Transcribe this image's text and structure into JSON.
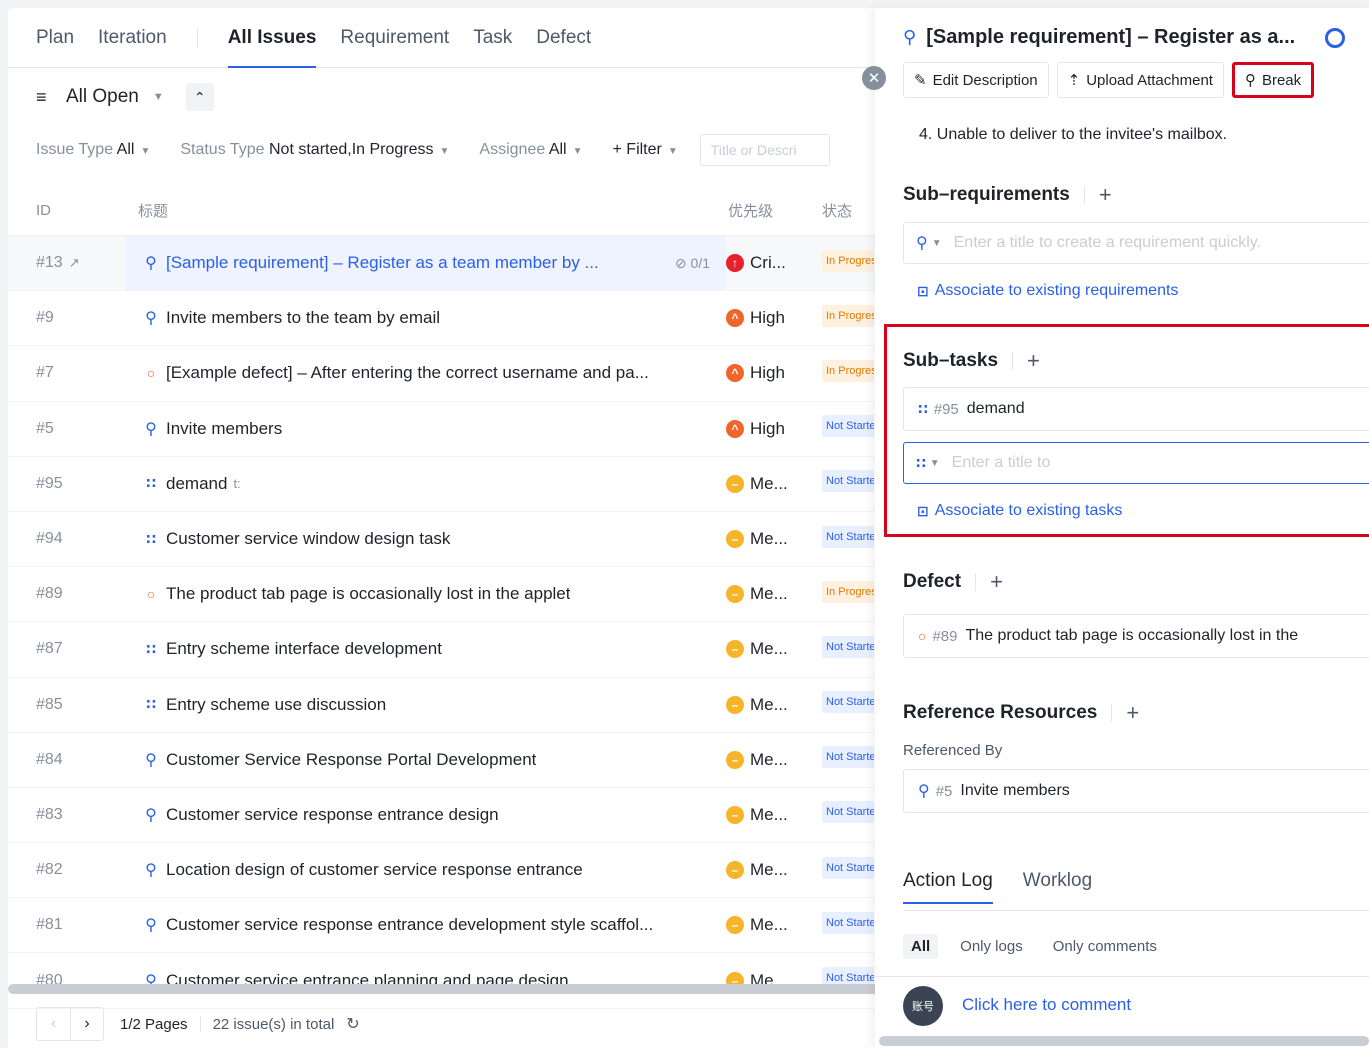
{
  "topnav": {
    "plan": "Plan",
    "iteration": "Iteration",
    "tabs": [
      "All Issues",
      "Requirement",
      "Task",
      "Defect"
    ]
  },
  "view": {
    "label": "All Open"
  },
  "filters": {
    "issue_type_label": "Issue Type",
    "issue_type_value": "All",
    "status_label": "Status Type",
    "status_value": "Not started,In Progress",
    "assignee_label": "Assignee",
    "assignee_value": "All",
    "add_filter": "+ Filter",
    "search_placeholder": "Title or Descri"
  },
  "table": {
    "headers": [
      "ID",
      "标题",
      "优先级",
      "状态"
    ],
    "rows": [
      {
        "id": "#13",
        "type": "requirement",
        "title": "[Sample requirement] – Register as a team member by ...",
        "sub": "0/1",
        "priority": "Cri...",
        "plevel": "critical",
        "status": "In Progress",
        "selected": true
      },
      {
        "id": "#9",
        "type": "requirement",
        "title": "Invite members to the team by email",
        "priority": "High",
        "plevel": "high",
        "status": "In Progress"
      },
      {
        "id": "#7",
        "type": "defect",
        "title": "[Example defect] – After entering the correct username and pa...",
        "priority": "High",
        "plevel": "high",
        "status": "In Progress"
      },
      {
        "id": "#5",
        "type": "requirement",
        "title": "Invite members",
        "priority": "High",
        "plevel": "high",
        "status": "Not Started"
      },
      {
        "id": "#95",
        "type": "task",
        "title": "demand",
        "suffix": "t:",
        "priority": "Me...",
        "plevel": "medium",
        "status": "Not Started"
      },
      {
        "id": "#94",
        "type": "task",
        "title": "Customer service window design task",
        "priority": "Me...",
        "plevel": "medium",
        "status": "Not Started"
      },
      {
        "id": "#89",
        "type": "defect",
        "title": "The product tab page is occasionally lost in the applet",
        "priority": "Me...",
        "plevel": "medium",
        "status": "In Progress"
      },
      {
        "id": "#87",
        "type": "task",
        "title": "Entry scheme interface development",
        "priority": "Me...",
        "plevel": "medium",
        "status": "Not Started"
      },
      {
        "id": "#85",
        "type": "task",
        "title": "Entry scheme use discussion",
        "priority": "Me...",
        "plevel": "medium",
        "status": "Not Started"
      },
      {
        "id": "#84",
        "type": "requirement",
        "title": "Customer Service Response Portal Development",
        "priority": "Me...",
        "plevel": "medium",
        "status": "Not Started"
      },
      {
        "id": "#83",
        "type": "requirement",
        "title": "Customer service response entrance design",
        "priority": "Me...",
        "plevel": "medium",
        "status": "Not Started"
      },
      {
        "id": "#82",
        "type": "requirement",
        "title": "Location design of customer service response entrance",
        "priority": "Me...",
        "plevel": "medium",
        "status": "Not Started"
      },
      {
        "id": "#81",
        "type": "requirement",
        "title": "Customer service response entrance development style scaffol...",
        "priority": "Me...",
        "plevel": "medium",
        "status": "Not Started"
      },
      {
        "id": "#80",
        "type": "requirement",
        "title": "Customer service entrance planning and page design",
        "priority": "Me...",
        "plevel": "medium",
        "status": "Not Started"
      }
    ]
  },
  "pager": {
    "pages": "1/2 Pages",
    "total": "22 issue(s) in total"
  },
  "detail": {
    "title": "[Sample requirement] – Register as a...",
    "toolbar": {
      "edit": "Edit Description",
      "upload": "Upload Attachment",
      "breakdown": "Break"
    },
    "description_tail": "4. Unable to deliver to the invitee's mailbox.",
    "subreq": {
      "title": "Sub–requirements",
      "placeholder": "Enter a title to create a requirement quickly.",
      "associate": "Associate to existing requirements"
    },
    "subtasks": {
      "title": "Sub–tasks",
      "item_id": "#95",
      "item_title": "demand",
      "placeholder": "Enter a title to",
      "associate": "Associate to existing tasks"
    },
    "defect": {
      "title": "Defect",
      "item_id": "#89",
      "item_title": "The product tab page is occasionally lost in the"
    },
    "reference": {
      "title": "Reference Resources",
      "sub": "Referenced By",
      "item_id": "#5",
      "item_title": "Invite members"
    },
    "tabs": {
      "log": "Action Log",
      "work": "Worklog"
    },
    "log_filters": [
      "All",
      "Only logs",
      "Only comments"
    ],
    "avatar": "账号",
    "comment": "Click here to comment"
  }
}
